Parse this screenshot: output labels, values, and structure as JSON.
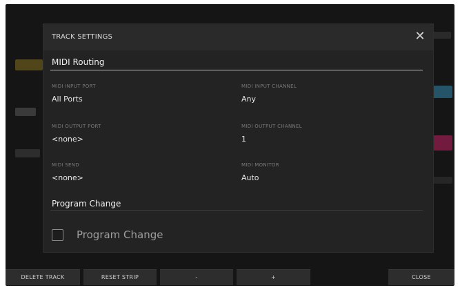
{
  "dialog": {
    "title": "TRACK SETTINGS",
    "close_glyph": "✕"
  },
  "midi_routing": {
    "heading": "MIDI Routing",
    "fields": [
      {
        "label": "MIDI INPUT PORT",
        "value": "All Ports"
      },
      {
        "label": "MIDI INPUT CHANNEL",
        "value": "Any"
      },
      {
        "label": "MIDI OUTPUT PORT",
        "value": "<none>"
      },
      {
        "label": "MIDI OUTPUT CHANNEL",
        "value": "1"
      },
      {
        "label": "MIDI SEND",
        "value": "<none>"
      },
      {
        "label": "MIDI MONITOR",
        "value": "Auto"
      }
    ]
  },
  "program_change": {
    "heading": "Program Change",
    "checkbox_label": "Program Change",
    "checked": false
  },
  "footer": {
    "buttons": [
      {
        "label": "DELETE TRACK"
      },
      {
        "label": "RESET STRIP"
      },
      {
        "label": "-"
      },
      {
        "label": "+"
      },
      {
        "label": "CLOSE"
      }
    ]
  },
  "colors": {
    "background": "#151515",
    "dialog": "#232323",
    "text": "#e6e6e6",
    "muted_label": "#7a7a7a"
  }
}
